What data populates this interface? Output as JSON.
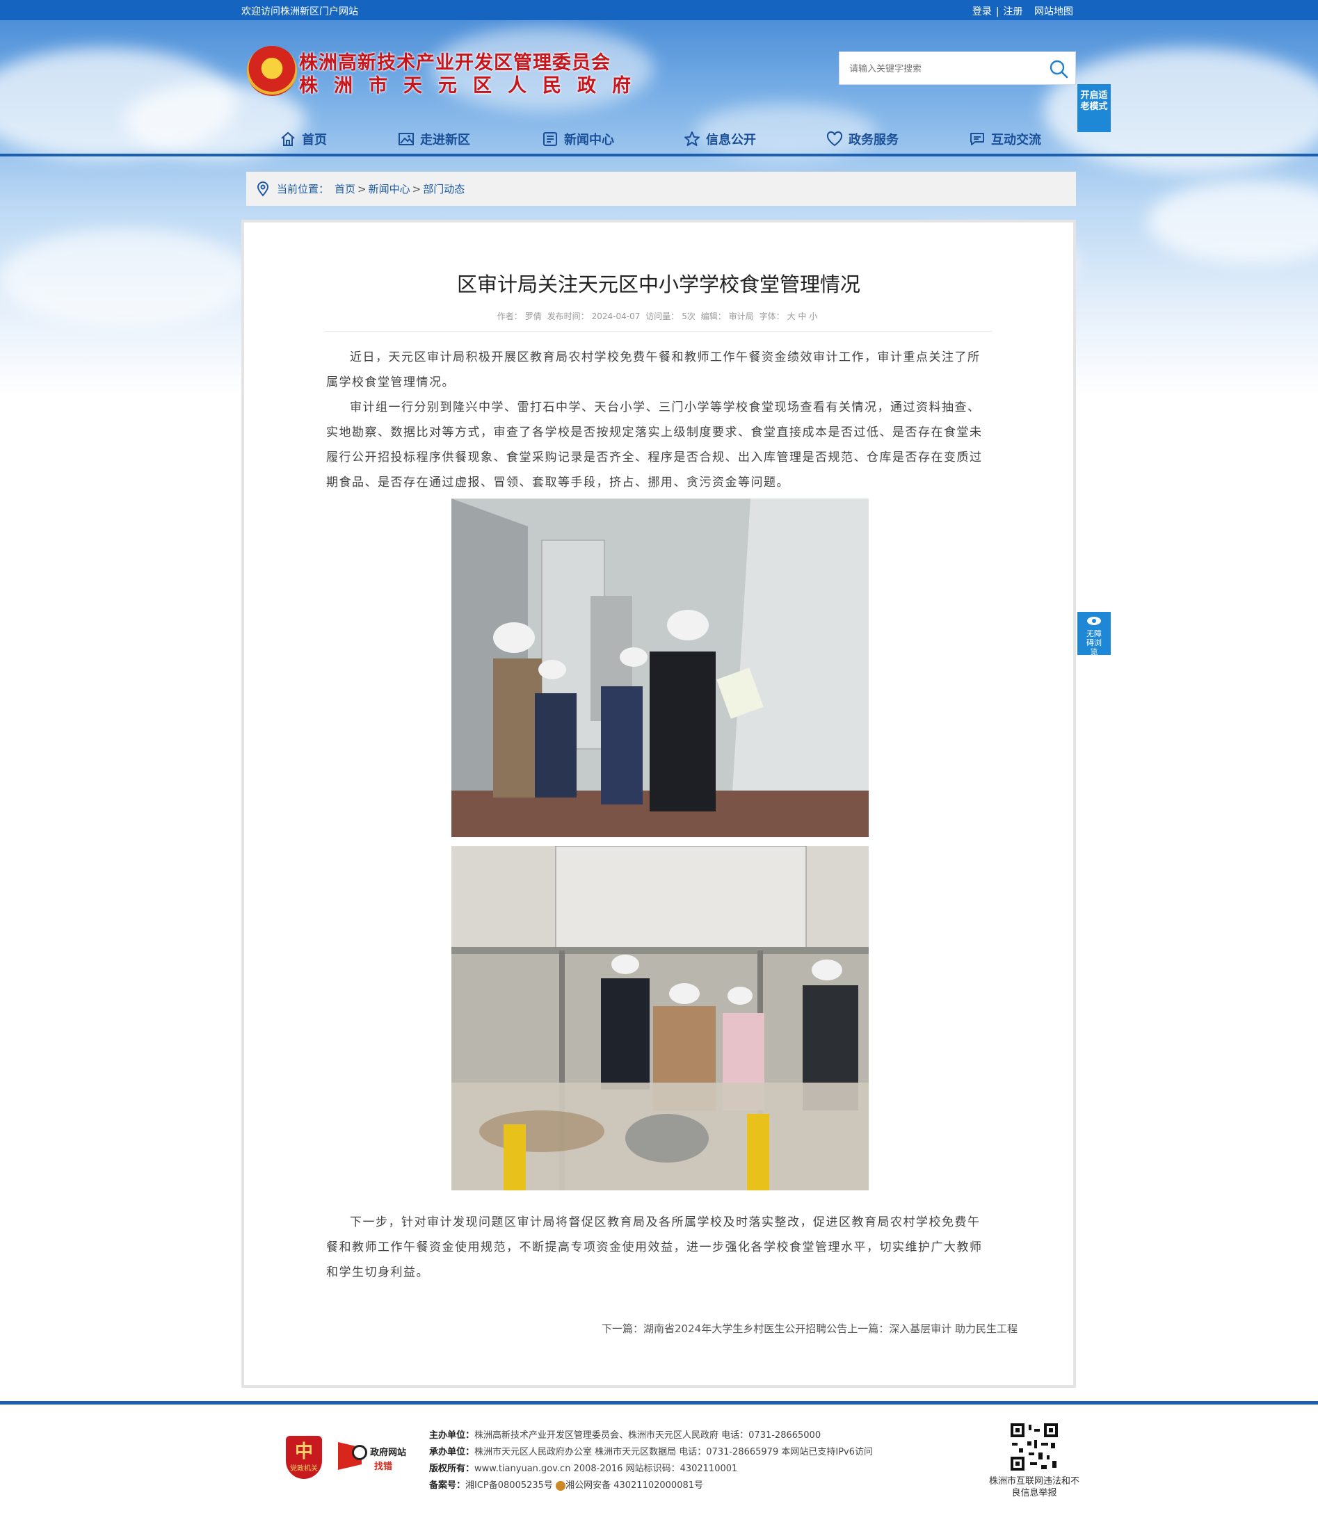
{
  "topbar": {
    "welcome": "欢迎访问株洲新区门户网站",
    "login": "登录",
    "register": "注册",
    "sitemap": "网站地图"
  },
  "header": {
    "title_line1": "株洲高新技术产业开发区管理委员会",
    "title_line2": "株洲市天元区人民政府",
    "search_placeholder": "请输入关键字搜索",
    "elder_mode": "开启适老模式"
  },
  "nav": {
    "items": [
      {
        "label": "首页",
        "icon": "home-icon"
      },
      {
        "label": "走进新区",
        "icon": "picture-icon"
      },
      {
        "label": "新闻中心",
        "icon": "newspaper-icon"
      },
      {
        "label": "信息公开",
        "icon": "star-icon"
      },
      {
        "label": "政务服务",
        "icon": "heart-hands-icon"
      },
      {
        "label": "互动交流",
        "icon": "chat-icon"
      }
    ]
  },
  "breadcrumb": {
    "prefix": "当前位置：",
    "items": [
      "首页",
      "新闻中心",
      "部门动态"
    ],
    "separator": ">"
  },
  "article": {
    "title": "区审计局关注天元区中小学学校食堂管理情况",
    "meta": {
      "author_label": "作者：",
      "author": "罗倩",
      "date_label": "发布时间：",
      "date": "2024-04-07",
      "views_label": "访问量：",
      "views": "5次",
      "editor_label": "编辑：",
      "editor": "审计局",
      "font_label": "字体：",
      "font_sizes": "大 中 小"
    },
    "paragraphs": [
      "近日，天元区审计局积极开展区教育局农村学校免费午餐和教师工作午餐资金绩效审计工作，审计重点关注了所属学校食堂管理情况。",
      "审计组一行分别到隆兴中学、雷打石中学、天台小学、三门小学等学校食堂现场查看有关情况，通过资料抽查、实地勘察、数据比对等方式，审查了各学校是否按规定落实上级制度要求、食堂直接成本是否过低、是否存在食堂未履行公开招投标程序供餐现象、食堂采购记录是否齐全、程序是否合规、出入库管理是否规范、仓库是否存在变质过期食品、是否存在通过虚报、冒领、套取等手段，挤占、挪用、贪污资金等问题。",
      "下一步，针对审计发现问题区审计局将督促区教育局及各所属学校及时落实整改，促进区教育局农村学校免费午餐和教师工作午餐资金使用规范，不断提高专项资金使用效益，进一步强化各学校食堂管理水平，切实维护广大教师和学生切身利益。"
    ],
    "next_label": "下一篇：",
    "next_title": "湖南省2024年大学生乡村医生公开招聘公告",
    "prev_label": "上一篇：",
    "prev_title": "深入基层审计 助力民生工程"
  },
  "sidebar": {
    "accessible_browse": "无障碍浏览"
  },
  "footer": {
    "badge1_big": "中",
    "badge1_small": "党政机关",
    "badge2_line1": "政府网站",
    "badge2_line2": "找错",
    "line1_label": "主办单位：",
    "line1": "株洲高新技术产业开发区管理委员会、株洲市天元区人民政府 电话：0731-28665000",
    "line2_label": "承办单位：",
    "line2": "株洲市天元区人民政府办公室 株洲市天元区数据局 电话：0731-28665979 本网站已支持IPv6访问",
    "line3_label": "版权所有：",
    "line3": "www.tianyuan.gov.cn 2008-2016 网站标识码：4302110001",
    "line4_label": "备案号：",
    "line4_icp": "湘ICP备08005235号",
    "line4_police": "湘公网安备 43021102000081号",
    "qr_caption": "株洲市互联网违法和不良信息举报"
  },
  "colors": {
    "topbar": "#1565c0",
    "nav_text": "#1a4f98",
    "title_red": "#c8151c",
    "accent_blue": "#1e88d6"
  }
}
